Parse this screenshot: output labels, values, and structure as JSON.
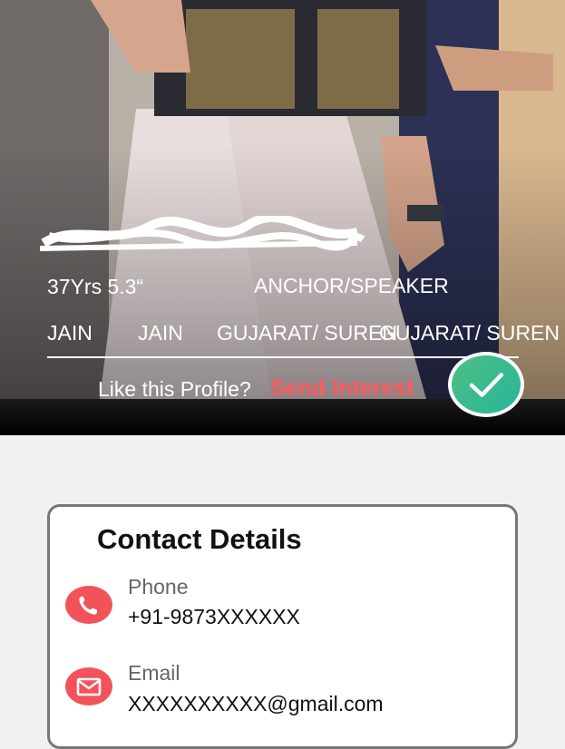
{
  "profile": {
    "age_height": "37Yrs  5.3“",
    "occupation": "ANCHOR/SPEAKER",
    "religion": "JAIN",
    "caste": "JAIN",
    "state_primary": "GUJARAT/ SUREN",
    "state_secondary": "GUJARAT/ SUREN"
  },
  "interest": {
    "prompt": "Like this Profile?",
    "action_label": "Send Interest",
    "icon": "check-icon"
  },
  "contact": {
    "title": "Contact Details",
    "phone_label": "Phone",
    "phone_value": "+91-9873XXXXXX",
    "email_label": "Email",
    "email_value": "XXXXXXXXXX@gmail.com",
    "icons": [
      "phone-icon",
      "email-icon"
    ]
  },
  "colors": {
    "accent": "#ff5a5f",
    "icon_bg": "#f2535b",
    "check_start": "#4fbf84",
    "check_end": "#26b59a"
  }
}
